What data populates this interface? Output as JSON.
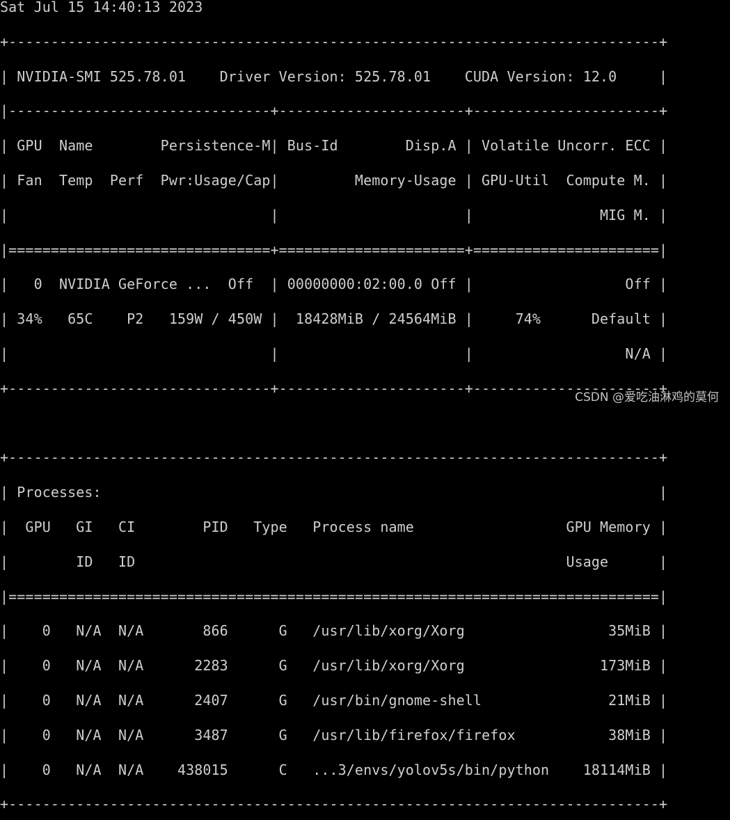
{
  "terminal": {
    "lines": [
      "Sat Jul 15 14:40:13 2023",
      "+-----------------------------------------------------------------------------+",
      "| NVIDIA-SMI 525.78.01    Driver Version: 525.78.01    CUDA Version: 12.0     |",
      "|-------------------------------+----------------------+----------------------+",
      "| GPU  Name        Persistence-M| Bus-Id        Disp.A | Volatile Uncorr. ECC |",
      "| Fan  Temp  Perf  Pwr:Usage/Cap|         Memory-Usage | GPU-Util  Compute M. |",
      "|                               |                      |               MIG M. |",
      "|===============================+======================+======================|",
      "|   0  NVIDIA GeForce ...  Off  | 00000000:02:00.0 Off |                  Off |",
      "| 34%   65C    P2   159W / 450W |  18428MiB / 24564MiB |     74%      Default |",
      "|                               |                      |                  N/A |",
      "+-------------------------------+----------------------+----------------------+",
      "",
      "+-----------------------------------------------------------------------------+",
      "| Processes:                                                                  |",
      "|  GPU   GI   CI        PID   Type   Process name                  GPU Memory |",
      "|        ID   ID                                                   Usage      |",
      "|=============================================================================|",
      "|    0   N/A  N/A       866      G   /usr/lib/xorg/Xorg                 35MiB |",
      "|    0   N/A  N/A      2283      G   /usr/lib/xorg/Xorg                173MiB |",
      "|    0   N/A  N/A      2407      G   /usr/bin/gnome-shell               21MiB |",
      "|    0   N/A  N/A      3487      G   /usr/lib/firefox/firefox           38MiB |",
      "|    0   N/A  N/A    438015      C   ...3/envs/yolov5s/bin/python    18114MiB |",
      "+-----------------------------------------------------------------------------+"
    ]
  },
  "watermark": {
    "text": "CSDN @爱吃油淋鸡的莫何"
  }
}
